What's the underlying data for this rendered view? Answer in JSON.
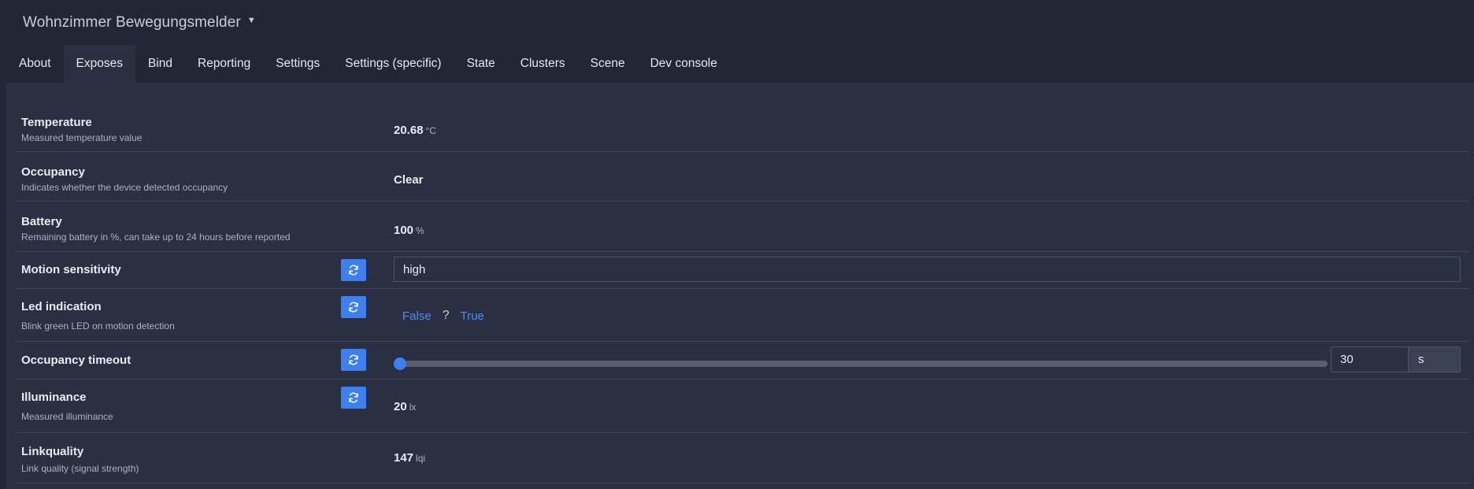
{
  "header": {
    "device_title": "Wohnzimmer Bewegungsmelder"
  },
  "tabs": [
    {
      "label": "About",
      "active": false
    },
    {
      "label": "Exposes",
      "active": true
    },
    {
      "label": "Bind",
      "active": false
    },
    {
      "label": "Reporting",
      "active": false
    },
    {
      "label": "Settings",
      "active": false
    },
    {
      "label": "Settings (specific)",
      "active": false
    },
    {
      "label": "State",
      "active": false
    },
    {
      "label": "Clusters",
      "active": false
    },
    {
      "label": "Scene",
      "active": false
    },
    {
      "label": "Dev console",
      "active": false
    }
  ],
  "exposes": {
    "temperature": {
      "label": "Temperature",
      "description": "Measured temperature value",
      "value": "20.68",
      "unit": "°C"
    },
    "occupancy": {
      "label": "Occupancy",
      "description": "Indicates whether the device detected occupancy",
      "value": "Clear"
    },
    "battery": {
      "label": "Battery",
      "description": "Remaining battery in %, can take up to 24 hours before reported",
      "value": "100",
      "unit": "%"
    },
    "motion_sensitivity": {
      "label": "Motion sensitivity",
      "value": "high"
    },
    "led_indication": {
      "label": "Led indication",
      "description": "Blink green LED on motion detection",
      "false_label": "False",
      "unknown_label": "?",
      "true_label": "True"
    },
    "occupancy_timeout": {
      "label": "Occupancy timeout",
      "value": "30",
      "unit": "s",
      "slider_fraction": 0.0
    },
    "illuminance": {
      "label": "Illuminance",
      "description": "Measured illuminance",
      "value": "20",
      "unit": "lx"
    },
    "linkquality": {
      "label": "Linkquality",
      "description": "Link quality (signal strength)",
      "value": "147",
      "unit": "lqi"
    }
  },
  "colors": {
    "accent": "#3c7ff0",
    "link": "#4b8ff0",
    "background": "#222736",
    "panel": "#2a3042"
  },
  "icons": {
    "refresh": "refresh-icon",
    "chevron": "chevron-down-icon"
  }
}
